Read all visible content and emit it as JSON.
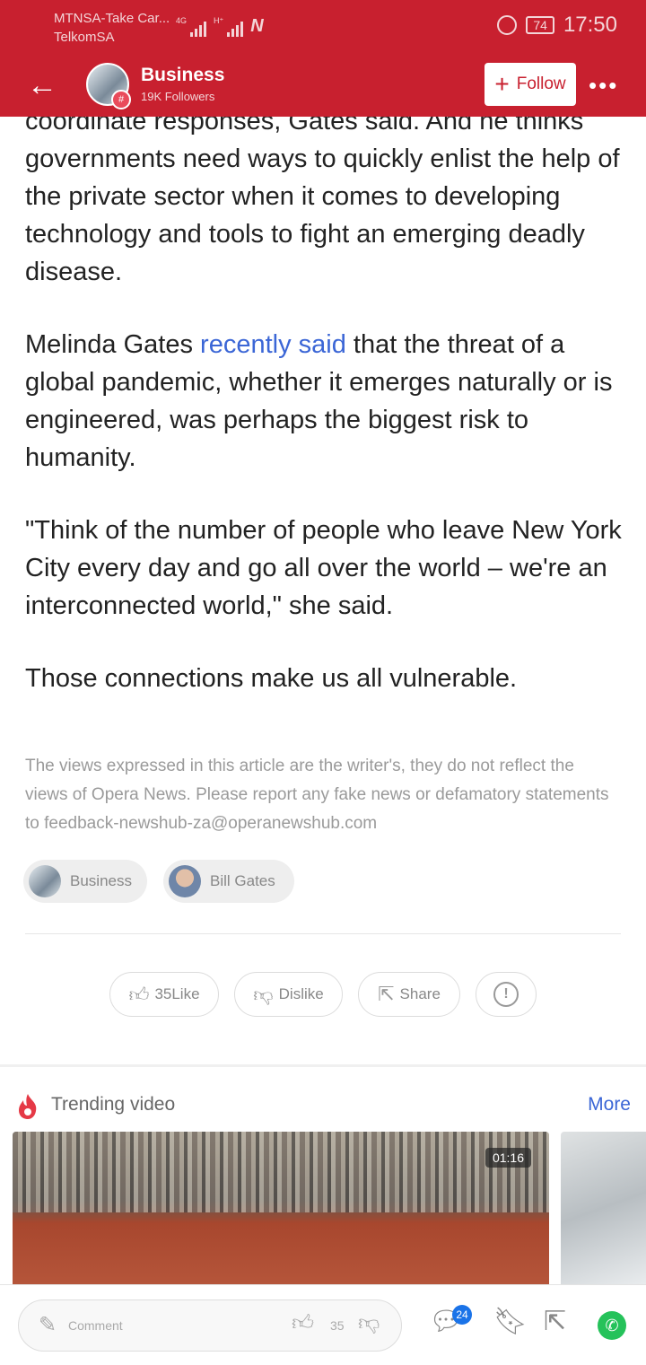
{
  "status_bar": {
    "carrier_1": "MTNSA-Take Car...",
    "carrier_2": "TelkomSA",
    "net_1": "4G",
    "net_2": "H⁺",
    "battery": "74",
    "time": "17:50"
  },
  "channel": {
    "name": "Business",
    "followers": "19K Followers",
    "follow_label": "Follow"
  },
  "article": {
    "p1": "coordinate responses, Gates said. And he thinks governments need ways to quickly enlist the help of the private sector when it comes to developing technology and tools to fight an emerging deadly disease.",
    "p2_before": "Melinda Gates ",
    "p2_link": "recently said",
    "p2_after": " that the threat of a global pandemic, whether it emerges naturally or is engineered, was perhaps the biggest risk to humanity.",
    "p3": "\"Think of the number of people who leave New York City every day and go all over the world – we're an interconnected world,\" she said.",
    "p4": "Those connections make us all vulnerable."
  },
  "disclaimer": "The views expressed in this article are the writer's, they do not reflect the views of Opera News. Please report any fake news or defamatory statements to feedback-newshub-za@operanewshub.com",
  "tags": [
    {
      "label": "Business"
    },
    {
      "label": "Bill Gates"
    }
  ],
  "actions": {
    "like": "35Like",
    "dislike": "Dislike",
    "share": "Share"
  },
  "trending": {
    "title": "Trending video",
    "more": "More",
    "video_duration": "01:16"
  },
  "bottom_bar": {
    "comment_placeholder": "Comment",
    "like_count": "35",
    "comments_badge": "24"
  },
  "colors": {
    "brand_red": "#c8202f",
    "link_blue": "#3b66d6"
  }
}
